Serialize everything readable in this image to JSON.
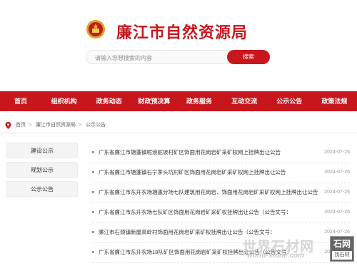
{
  "header": {
    "site_title": "廉江市自然资源局",
    "search_placeholder": "请输入您想搜索的内容",
    "search_button": "搜索"
  },
  "nav": [
    "首页",
    "组织机构",
    "政务动态",
    "财政预决算",
    "政务服务",
    "互动交流",
    "公示公告",
    "政策法规"
  ],
  "breadcrumb": [
    "首页",
    "廉江市自然资源局",
    "公示公告"
  ],
  "sidebar": [
    "建设公示",
    "规划公示",
    "公示公告"
  ],
  "articles": [
    {
      "title": "广东省廉江市塘蓬镇呢浪蛇坡村矿区饰面用花岗岩矿采矿权网上挂牌出让公告",
      "date": "2024-07-26"
    },
    {
      "title": "广东省廉江市塘蓬镇石宁茅头坑村矿区饰面用花岗岩矿采矿权网上挂牌出让公告",
      "date": "2024-07-26"
    },
    {
      "title": "广东省廉江市东升农场塘蓬分场七队建筑用花岗岩、饰面用花岗岩矿采矿权网上挂牌出让公告",
      "date": "2024-07-26"
    },
    {
      "title": "广东省廉江市东升农场七队矿区饰面用花岗岩矿采矿权挂牌出让公告（公告文号：",
      "date": "2024-07-26"
    },
    {
      "title": "廉江市石颈镇新屋高岭村饰面用花岗岩矿采矿权挂牌出让公告（公告文号：",
      "date": "2024-07-26"
    },
    {
      "title": "广东省廉江市东升农场18队矿区饰面用花岗岩矿采矿权挂牌出让公告（公告文号：",
      "date": "2024-07-26"
    }
  ],
  "watermark": {
    "cn": "世界石材网",
    "en": "world-stone.com",
    "seal_top": "石网",
    "seal_bottom": "找石材"
  }
}
